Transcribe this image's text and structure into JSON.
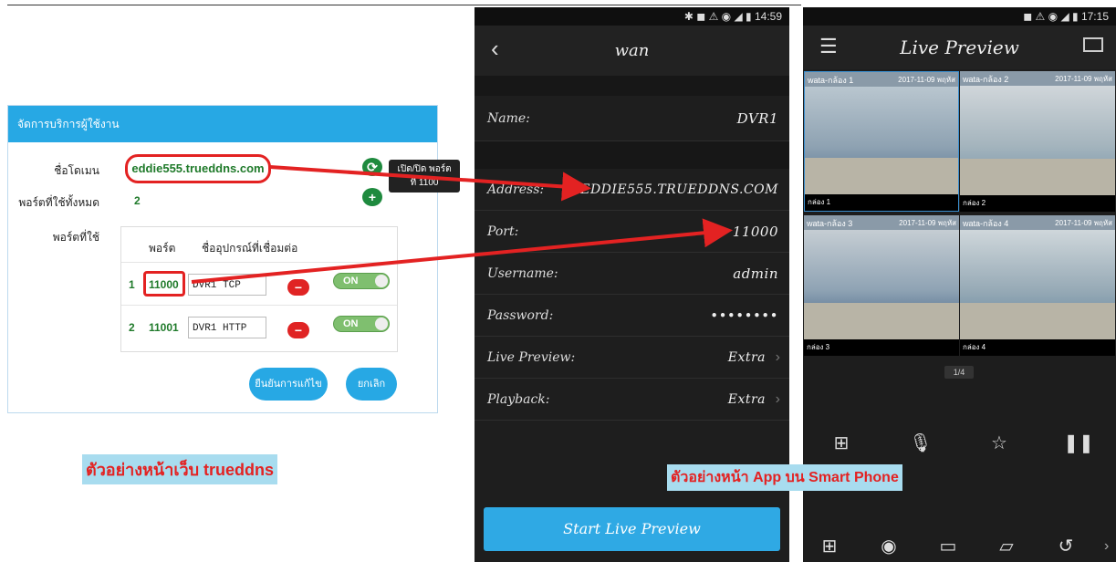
{
  "web": {
    "header_title": "จัดการบริการผู้ใช้งาน",
    "domain_label": "ชื่อโดเมน",
    "domain_value": "eddie555.trueddns.com",
    "refresh_icon": "refresh-icon",
    "ports_total_label": "พอร์ตที่ใช้ทั้งหมด",
    "ports_total_value": "2",
    "add_icon": "plus-icon",
    "ports_used_label": "พอร์ตที่ใช้",
    "table": {
      "col_port": "พอร์ต",
      "col_device": "ชื่ออุปกรณ์ที่เชื่อมต่อ",
      "rows": [
        {
          "num": "1",
          "port": "11000",
          "device": "DVR1 TCP",
          "toggle": "ON"
        },
        {
          "num": "2",
          "port": "11001",
          "device": "DVR1 HTTP",
          "toggle": "ON"
        }
      ]
    },
    "tooltip_line1": "เปิด/ปิด พอร์ต",
    "tooltip_line2": "ที่ 1100",
    "confirm_button": "ยืนยันการแก้ไข",
    "cancel_button": "ยกเลิก",
    "caption": "ตัวอย่างหน้าเว็บ trueddns"
  },
  "phone1": {
    "status": "✱ ◼ ⚠ ◉ ◢ ▮ 14:59",
    "title": "wan",
    "fields": {
      "name_label": "Name:",
      "name_value": "DVR1",
      "address_label": "Address:",
      "address_value": "EDDIE555.TRUEDDNS.COM",
      "port_label": "Port:",
      "port_value": "11000",
      "username_label": "Username:",
      "username_value": "admin",
      "password_label": "Password:",
      "password_value": "••••••••",
      "live_label": "Live Preview:",
      "live_value": "Extra",
      "playback_label": "Playback:",
      "playback_value": "Extra"
    },
    "start_button": "Start Live Preview"
  },
  "phone2": {
    "status": "◼ ⚠ ◉ ◢ ▮ 17:15",
    "title": "Live Preview",
    "cams": [
      {
        "name": "wata-กล้อง 1",
        "ts": "2017-11-09 พฤหัส",
        "ch": "กล่อง 1"
      },
      {
        "name": "wata-กล้อง 2",
        "ts": "2017-11-09 พฤหัส",
        "ch": "กล่อง 2"
      },
      {
        "name": "wata-กล้อง 3",
        "ts": "2017-11-09 พฤหัส",
        "ch": "กล่อง 3"
      },
      {
        "name": "wata-กล้อง 4",
        "ts": "2017-11-09 พฤหัส",
        "ch": "กล่อง 4"
      }
    ],
    "page_indicator": "1/4",
    "caption": "ตัวอย่างหน้า App บน Smart Phone"
  },
  "colors": {
    "accent": "#27a8e4",
    "highlight": "#e32222",
    "green": "#1f7a2a"
  }
}
